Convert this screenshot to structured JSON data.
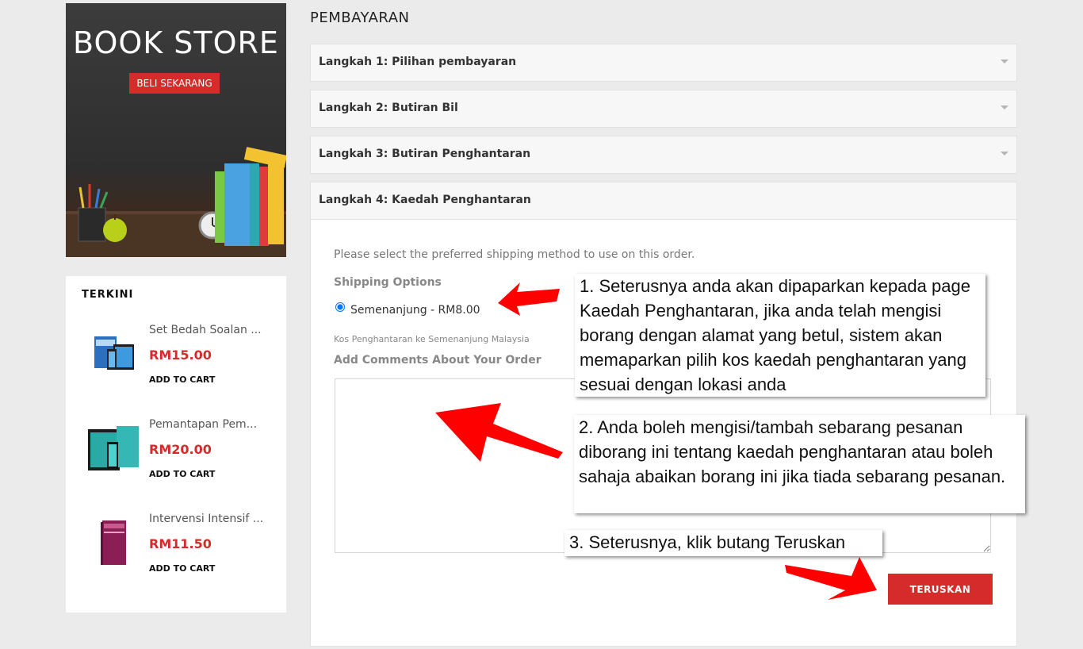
{
  "banner": {
    "title": "BOOK STORE",
    "button_label": "BELI SEKARANG"
  },
  "sidebar": {
    "title": "TERKINI",
    "products": [
      {
        "name": "Set Bedah Soalan ...",
        "price": "RM15.00",
        "cart": "ADD TO CART"
      },
      {
        "name": "Pemantapan Pem...",
        "price": "RM20.00",
        "cart": "ADD TO CART"
      },
      {
        "name": "Intervensi Intensif ...",
        "price": "RM11.50",
        "cart": "ADD TO CART"
      }
    ]
  },
  "checkout": {
    "title": "PEMBAYARAN",
    "steps": [
      {
        "label": "Langkah 1: Pilihan pembayaran"
      },
      {
        "label": "Langkah 2: Butiran Bil"
      },
      {
        "label": "Langkah 3: Butiran Penghantaran"
      },
      {
        "label": "Langkah 4: Kaedah Penghantaran"
      }
    ],
    "intro": "Please select the preferred shipping method to use on this order.",
    "shipping_heading": "Shipping Options",
    "shipping_option": "Semenanjung - RM8.00",
    "shipping_note": "Kos Penghantaran ke Semenanjung Malaysia",
    "comments_heading": "Add Comments About Your Order",
    "comments_value": "",
    "continue_label": "TERUSKAN"
  },
  "annotations": {
    "note1": "1. Seterusnya anda akan dipaparkan kepada page Kaedah Penghantaran, jika anda telah mengisi borang dengan alamat yang betul, sistem akan memaparkan pilih kos kaedah penghantaran yang sesuai dengan lokasi anda",
    "note2": "2. Anda boleh mengisi/tambah sebarang pesanan diborang ini tentang kaedah penghantaran atau boleh sahaja abaikan borang ini jika tiada sebarang pesanan.",
    "note3": "3. Seterusnya, klik butang Teruskan"
  },
  "colors": {
    "accent": "#d52b2b",
    "arrow": "#ff0000",
    "background": "#ebebeb"
  }
}
